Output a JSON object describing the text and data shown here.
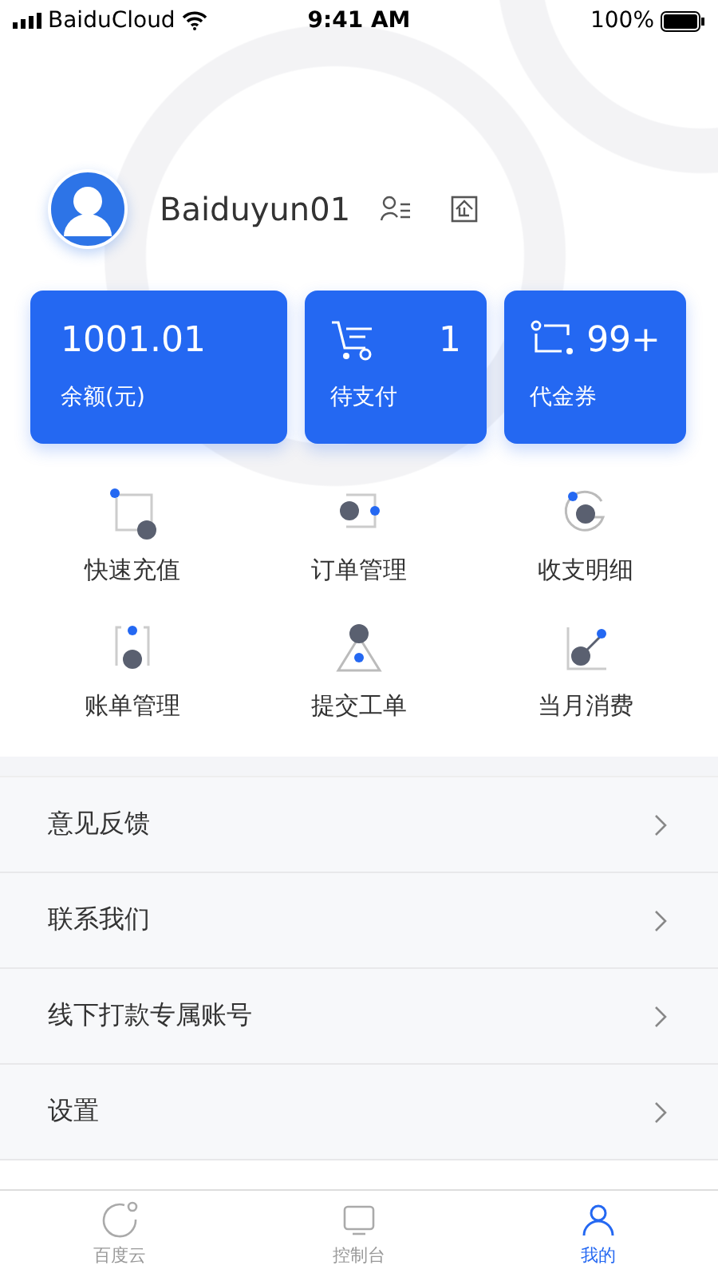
{
  "status_bar": {
    "carrier": "BaiduCloud",
    "time": "9:41 AM",
    "battery": "100%"
  },
  "profile": {
    "username": "Baiduyun01"
  },
  "cards": [
    {
      "kind": "balance",
      "value": "1001.01",
      "label": "余额(元)"
    },
    {
      "kind": "cart",
      "value": "1",
      "label": "待支付"
    },
    {
      "kind": "coupon",
      "value": "99+",
      "label": "代金券"
    }
  ],
  "shortcuts": [
    {
      "kind": "recharge",
      "label": "快速充值"
    },
    {
      "kind": "orders",
      "label": "订单管理"
    },
    {
      "kind": "ledger",
      "label": "收支明细"
    },
    {
      "kind": "bills",
      "label": "账单管理"
    },
    {
      "kind": "ticket",
      "label": "提交工单"
    },
    {
      "kind": "monthly",
      "label": "当月消费"
    }
  ],
  "menu": [
    {
      "label": "意见反馈"
    },
    {
      "label": "联系我们"
    },
    {
      "label": "线下打款专属账号"
    },
    {
      "label": "设置"
    }
  ],
  "tab_bar": [
    {
      "kind": "cloud",
      "label": "百度云",
      "selected": false
    },
    {
      "kind": "console",
      "label": "控制台",
      "selected": false
    },
    {
      "kind": "me",
      "label": "我的",
      "selected": true
    }
  ]
}
